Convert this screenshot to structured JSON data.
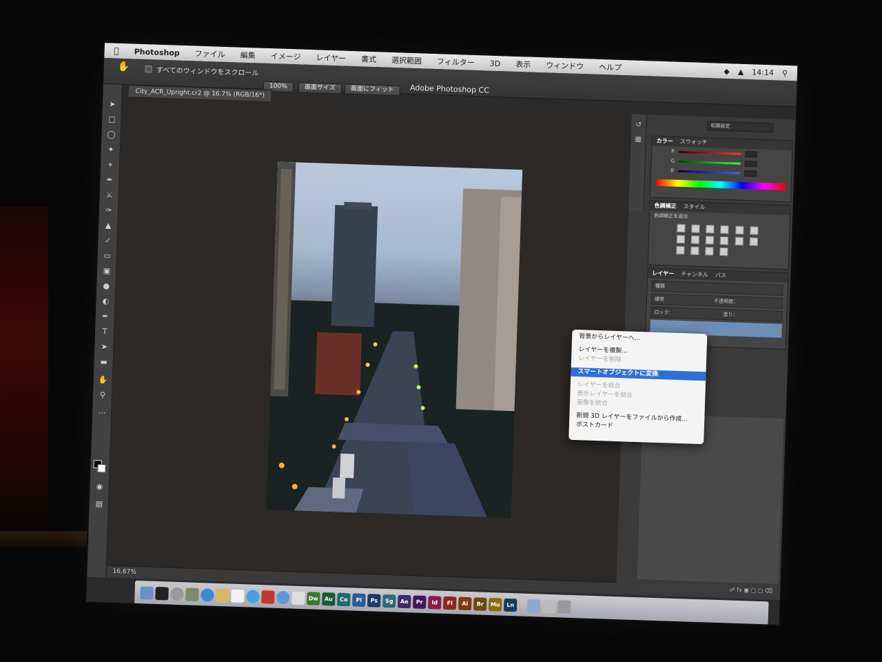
{
  "menubar": {
    "app_name": "Photoshop",
    "items": [
      "ファイル",
      "編集",
      "イメージ",
      "レイヤー",
      "書式",
      "選択範囲",
      "フィルター",
      "3D",
      "表示",
      "ウィンドウ",
      "ヘルプ"
    ],
    "clock": "14:14"
  },
  "window": {
    "title": "Adobe Photoshop CC"
  },
  "options_bar": {
    "scroll_all_windows": "すべてのウィンドウをスクロール",
    "buttons": [
      "100%",
      "画面サイズ",
      "画面にフィット"
    ]
  },
  "document": {
    "tab_title": "City_ACR_Upright.cr2 @ 16.7% (RGB/16*)"
  },
  "status": {
    "zoom": "16.67%"
  },
  "workspace": {
    "label": "初期設定"
  },
  "panels": {
    "color": {
      "tabs": [
        "カラー",
        "スウォッチ"
      ],
      "sliders": [
        "R",
        "G",
        "B"
      ]
    },
    "adjustments": {
      "tabs": [
        "色調補正",
        "スタイル"
      ],
      "hint": "色調補正を追加"
    },
    "layers": {
      "tabs": [
        "レイヤー",
        "チャンネル",
        "パス"
      ],
      "filter_label": "種類",
      "blend_mode": "通常",
      "opacity_label": "不透明度：",
      "lock_label": "ロック：",
      "fill_label": "塗り："
    }
  },
  "context_menu": {
    "items": [
      {
        "label": "背景からレイヤーへ...",
        "state": "enabled"
      },
      {
        "label": "レイヤーを複製...",
        "state": "enabled"
      },
      {
        "label": "レイヤーを削除",
        "state": "disabled"
      },
      {
        "label": "スマートオブジェクトに変換",
        "state": "selected"
      },
      {
        "label": "レイヤーを結合",
        "state": "disabled"
      },
      {
        "label": "表示レイヤーを結合",
        "state": "disabled"
      },
      {
        "label": "画像を統合",
        "state": "disabled"
      },
      {
        "label": "新規 3D レイヤーをファイルから作成...",
        "state": "enabled"
      },
      {
        "label": "ポストカード",
        "state": "enabled"
      }
    ]
  },
  "dock": {
    "cc_apps": [
      "Dw",
      "Au",
      "Co",
      "Pl",
      "Ps",
      "Sg",
      "Ae",
      "Pr",
      "Id",
      "Fl",
      "Ai",
      "Br",
      "Mu",
      "Ln"
    ]
  }
}
